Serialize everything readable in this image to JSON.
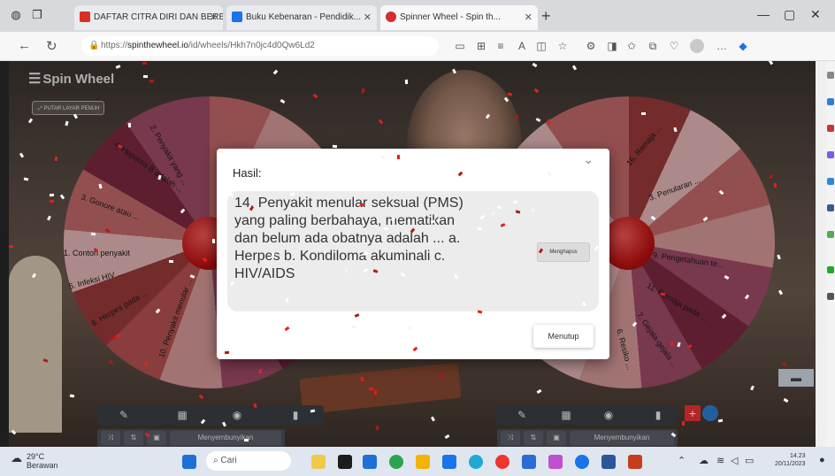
{
  "browser": {
    "tabs": [
      {
        "label": "DAFTAR CITRA DIRI DAN BERBUAT",
        "color": "#d93025"
      },
      {
        "label": "Buku Kebenaran - Pendidik...",
        "color": "#1a73e8"
      },
      {
        "label": "Spinner Wheel - Spin th...",
        "color": "#d32f2f"
      }
    ],
    "url_prefix": "https://",
    "url_domain": "spinthewheel.io",
    "url_path": "/id/wheels/Hkh7n0jc4d0Qw6Ld2",
    "controls": {
      "minimize": "—",
      "maximize": "▢",
      "close": "✕"
    }
  },
  "app": {
    "logo": "Spin Wheel",
    "fullscreen_label": "PUTAR LAYAR PENUH"
  },
  "left_wheel": {
    "labels": [
      "4. Hepatitis B adalah ...",
      "2. Penyakit yang ...",
      "3. Gonore atau ...",
      "1. Contoh penyakit",
      "5. Infeksi HIV ...",
      "8. Herpes pada ...",
      "10. Penyakit menular ..."
    ]
  },
  "right_wheel": {
    "labels": [
      "16. Remaja ...",
      "9. Pengetahuan te...",
      "3. Penularan ...",
      "11. Remaja pada ...",
      "7. Gejala-gejala ...",
      "6. Resiko ..."
    ]
  },
  "dialog": {
    "title": "Hasil:",
    "result": "14. Penyakit menular seksual (PMS) yang paling berbahaya, mematikan dan belum ada obatnya adalah ... a. Herpes b. Kondiloma akuminali c. HIV/AIDS",
    "delete_label": "Menghapus",
    "close_label": "Menutup"
  },
  "controls": {
    "sub_button": "Menyembunyikan"
  },
  "taskbar": {
    "weather_temp": "29°C",
    "weather_desc": "Berawan",
    "search_placeholder": "Cari",
    "time": "14.23",
    "date": "20/11/2023"
  }
}
